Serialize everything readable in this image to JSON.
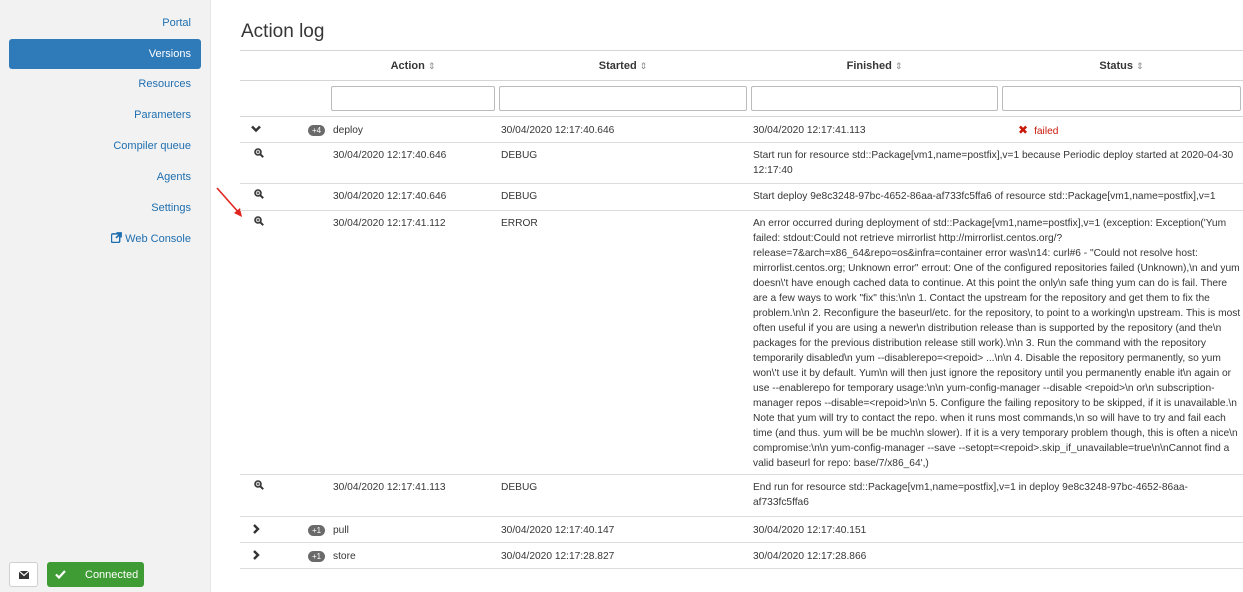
{
  "sidebar": {
    "items": [
      {
        "label": "Portal",
        "active": false
      },
      {
        "label": "Versions",
        "active": true
      },
      {
        "label": "Resources",
        "active": false
      },
      {
        "label": "Parameters",
        "active": false
      },
      {
        "label": "Compiler queue",
        "active": false
      },
      {
        "label": "Agents",
        "active": false
      },
      {
        "label": "Settings",
        "active": false
      },
      {
        "label": "Web Console",
        "active": false,
        "icon": "external-link-icon"
      }
    ],
    "footer": {
      "mail_icon": "envelope-icon",
      "status_label": "Connected",
      "status_icon": "check-icon"
    }
  },
  "page": {
    "title": "Action log"
  },
  "table": {
    "columns": [
      "Action",
      "Started",
      "Finished",
      "Status"
    ],
    "sort_icon": "⇕",
    "rows": [
      {
        "kind": "group",
        "expanded": true,
        "count": "+4",
        "action": "deploy",
        "started": "30/04/2020 12:17:40.646",
        "finished": "30/04/2020 12:17:41.113",
        "status": "failed"
      },
      {
        "kind": "log",
        "time": "30/04/2020 12:17:40.646",
        "level": "DEBUG",
        "message": "Start run for resource std::Package[vm1,name=postfix],v=1 because Periodic deploy started at 2020-04-30 12:17:40"
      },
      {
        "kind": "log",
        "time": "30/04/2020 12:17:40.646",
        "level": "DEBUG",
        "message": "Start deploy 9e8c3248-97bc-4652-86aa-af733fc5ffa6 of resource std::Package[vm1,name=postfix],v=1"
      },
      {
        "kind": "log",
        "time": "30/04/2020 12:17:41.112",
        "level": "ERROR",
        "message": "An error occurred during deployment of std::Package[vm1,name=postfix],v=1 (exception: Exception('Yum failed: stdout:Could not retrieve mirrorlist http://mirrorlist.centos.org/?release=7&arch=x86_64&repo=os&infra=container error was\\n14: curl#6 - \"Could not resolve host: mirrorlist.centos.org; Unknown error\" errout: One of the configured repositories failed (Unknown),\\n and yum doesn\\'t have enough cached data to continue. At this point the only\\n safe thing yum can do is fail. There are a few ways to work \"fix\" this:\\n\\n 1. Contact the upstream for the repository and get them to fix the problem.\\n\\n 2. Reconfigure the baseurl/etc. for the repository, to point to a working\\n upstream. This is most often useful if you are using a newer\\n distribution release than is supported by the repository (and the\\n packages for the previous distribution release still work).\\n\\n 3. Run the command with the repository temporarily disabled\\n yum --disablerepo=<repoid> ...\\n\\n 4. Disable the repository permanently, so yum won\\'t use it by default. Yum\\n will then just ignore the repository until you permanently enable it\\n again or use --enablerepo for temporary usage:\\n\\n yum-config-manager --disable <repoid>\\n or\\n subscription-manager repos --disable=<repoid>\\n\\n 5. Configure the failing repository to be skipped, if it is unavailable.\\n Note that yum will try to contact the repo. when it runs most commands,\\n so will have to try and fail each time (and thus. yum will be be much\\n slower). If it is a very temporary problem though, this is often a nice\\n compromise:\\n\\n yum-config-manager --save --setopt=<repoid>.skip_if_unavailable=true\\n\\nCannot find a valid baseurl for repo: base/7/x86_64',)"
      },
      {
        "kind": "log",
        "time": "30/04/2020 12:17:41.113",
        "level": "DEBUG",
        "message": "End run for resource std::Package[vm1,name=postfix],v=1 in deploy 9e8c3248-97bc-4652-86aa-af733fc5ffa6"
      },
      {
        "kind": "group",
        "expanded": false,
        "count": "+1",
        "action": "pull",
        "started": "30/04/2020 12:17:40.147",
        "finished": "30/04/2020 12:17:40.151",
        "status": ""
      },
      {
        "kind": "group",
        "expanded": false,
        "count": "+1",
        "action": "store",
        "started": "30/04/2020 12:17:28.827",
        "finished": "30/04/2020 12:17:28.866",
        "status": ""
      }
    ]
  },
  "colors": {
    "accent": "#2f7ab9",
    "link": "#1f6fb0",
    "connected": "#3f9c35",
    "error": "#c9190b",
    "annotation_arrow": "#e0241f"
  }
}
